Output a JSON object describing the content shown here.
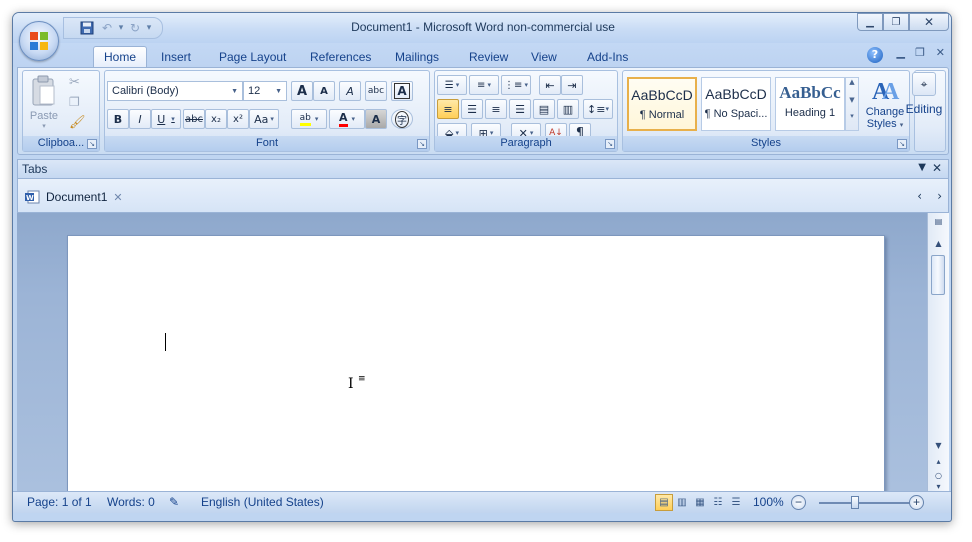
{
  "window": {
    "title": "Document1 - Microsoft Word non-commercial use"
  },
  "quick_access": {
    "save_icon": "save-icon",
    "undo_icon": "undo-icon",
    "redo_icon": "redo-icon"
  },
  "ribbon_tabs": [
    "Home",
    "Insert",
    "Page Layout",
    "References",
    "Mailings",
    "Review",
    "View",
    "Add-Ins"
  ],
  "clipboard": {
    "paste_label": "Paste",
    "group_label": "Clipboa..."
  },
  "font": {
    "font_name": "Calibri (Body)",
    "font_size": "12",
    "group_label": "Font",
    "bold": "B",
    "italic": "I",
    "underline": "U",
    "strike": "abc",
    "subscript": "x₂",
    "superscript": "x²",
    "change_case": "Aa",
    "grow": "A",
    "shrink": "A",
    "clear": "A",
    "font_color_letter": "A",
    "char_shade": "A",
    "highlight": "ab",
    "abc_label": "abc",
    "phonetic": "字"
  },
  "paragraph": {
    "group_label": "Paragraph",
    "pilcrow": "¶"
  },
  "styles": {
    "group_label": "Styles",
    "tiles": [
      {
        "sample": "AaBbCcD",
        "name": "¶ Normal"
      },
      {
        "sample": "AaBbCcD",
        "name": "¶ No Spaci..."
      },
      {
        "sample": "AaBbCc",
        "name": "Heading 1"
      }
    ],
    "change_styles_line1": "Change",
    "change_styles_line2": "Styles"
  },
  "editing": {
    "label": "Editing"
  },
  "tabs_pane": {
    "title": "Tabs",
    "document_tab": "Document1"
  },
  "status": {
    "page": "Page: 1 of 1",
    "words": "Words: 0",
    "language": "English (United States)",
    "zoom": "100%",
    "zoom_minus": "−",
    "zoom_plus": "+"
  },
  "colors": {
    "ribbon_text": "#15428b",
    "highlight_yellow": "#ffff00",
    "font_color_red": "#ff0000",
    "selected_button": "#ffcf58"
  }
}
